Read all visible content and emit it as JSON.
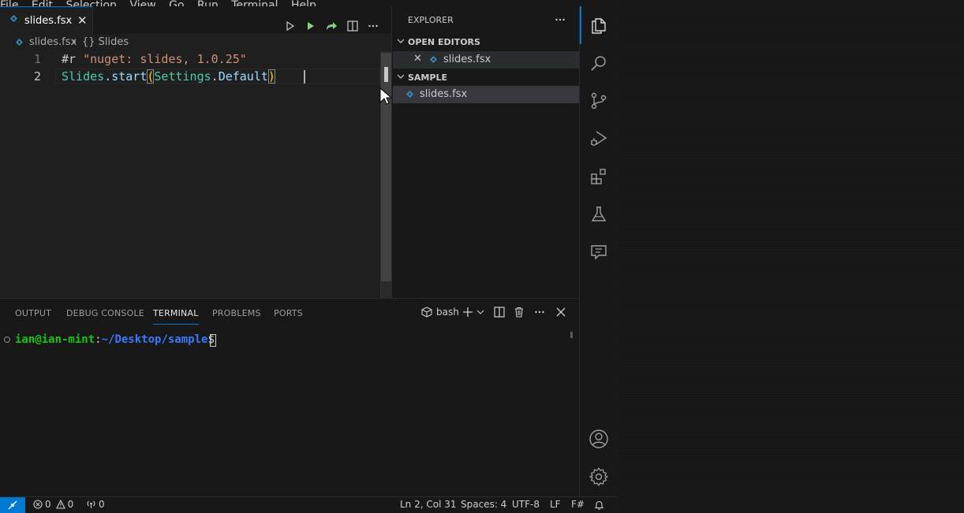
{
  "menu": [
    "File",
    "Edit",
    "Selection",
    "View",
    "Go",
    "Run",
    "Terminal",
    "Help"
  ],
  "editor": {
    "tab_label": "slides.fsx",
    "breadcrumb_file": "slides.fsx",
    "breadcrumb_symbol": "{} Slides",
    "lines": [
      {
        "num": "1",
        "tokens": [
          {
            "t": "#r ",
            "c": "#cccccc"
          },
          {
            "t": "\"nuget: slides, 1.0.25\"",
            "c": "#ce9178"
          }
        ]
      },
      {
        "num": "2",
        "tokens": [
          {
            "t": "Slides",
            "c": "#4ec9b0"
          },
          {
            "t": ".start",
            "c": "#9cdcfe"
          },
          {
            "t": "(",
            "c": "#ffd700"
          },
          {
            "t": "Settings",
            "c": "#4ec9b0"
          },
          {
            "t": ".",
            "c": "#cccccc"
          },
          {
            "t": "Default",
            "c": "#9cdcfe"
          },
          {
            "t": ")",
            "c": "#ffd700"
          }
        ]
      }
    ],
    "cursor_line": 2
  },
  "sidebar": {
    "title": "EXPLORER",
    "open_editors_header": "OPEN EDITORS",
    "open_editors": [
      {
        "label": "slides.fsx"
      }
    ],
    "folder_header": "SAMPLE",
    "files": [
      {
        "label": "slides.fsx"
      }
    ]
  },
  "panel": {
    "tabs": [
      "OUTPUT",
      "DEBUG CONSOLE",
      "TERMINAL",
      "PROBLEMS",
      "PORTS"
    ],
    "active_tab": "TERMINAL",
    "terminal_name": "bash",
    "prompt_user": "ian@ian-mint",
    "prompt_sep": ":",
    "prompt_path": "~/Desktop/sample",
    "prompt_end": "$ "
  },
  "status": {
    "errors": "0",
    "warnings": "0",
    "ports": "0",
    "position": "Ln 2, Col 31",
    "spaces": "Spaces: 4",
    "encoding": "UTF-8",
    "eol": "LF",
    "language": "F#"
  },
  "colors": {
    "accent": "#0078d4",
    "fsharp_icon": "#378bba",
    "terminal_green": "#16c60c",
    "terminal_blue": "#3b78ff",
    "run_green": "#89d185"
  }
}
